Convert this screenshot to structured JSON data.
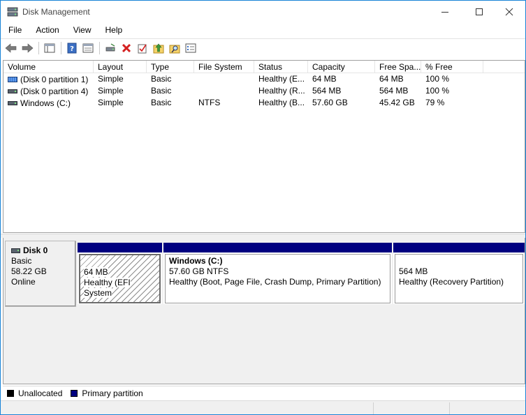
{
  "window": {
    "title": "Disk Management",
    "accent": "#1883d7"
  },
  "menu": [
    "File",
    "Action",
    "View",
    "Help"
  ],
  "toolbar": {
    "buttons": [
      "back-arrow-icon",
      "forward-arrow-icon",
      "show-hide-console-tree-icon",
      "help-icon",
      "properties-pane-icon",
      "connect-drive-icon",
      "delete-icon",
      "check-icon",
      "up-folder-icon",
      "search-folder-icon",
      "properties-icon"
    ]
  },
  "columns": [
    "Volume",
    "Layout",
    "Type",
    "File System",
    "Status",
    "Capacity",
    "Free Spa...",
    "% Free"
  ],
  "volumes": [
    {
      "volume": "(Disk 0 partition 1)",
      "layout": "Simple",
      "type": "Basic",
      "fs": "",
      "status": "Healthy (E...",
      "capacity": "64 MB",
      "free": "64 MB",
      "pct": "100 %"
    },
    {
      "volume": "(Disk 0 partition 4)",
      "layout": "Simple",
      "type": "Basic",
      "fs": "",
      "status": "Healthy (R...",
      "capacity": "564 MB",
      "free": "564 MB",
      "pct": "100 %"
    },
    {
      "volume": "Windows (C:)",
      "layout": "Simple",
      "type": "Basic",
      "fs": "NTFS",
      "status": "Healthy (B...",
      "capacity": "57.60 GB",
      "free": "45.42 GB",
      "pct": "79 %"
    }
  ],
  "disk": {
    "name": "Disk 0",
    "type": "Basic",
    "size": "58.22 GB",
    "state": "Online"
  },
  "partitions": [
    {
      "title": "",
      "size": "64 MB",
      "status": "Healthy (EFI System"
    },
    {
      "title": "Windows  (C:)",
      "size": "57.60 GB NTFS",
      "status": "Healthy (Boot, Page File, Crash Dump, Primary Partition)"
    },
    {
      "title": "",
      "size": "564 MB",
      "status": "Healthy (Recovery Partition)"
    }
  ],
  "legend": {
    "unallocated": "Unallocated",
    "unallocated_color": "#000000",
    "primary": "Primary partition",
    "primary_color": "#000080"
  }
}
